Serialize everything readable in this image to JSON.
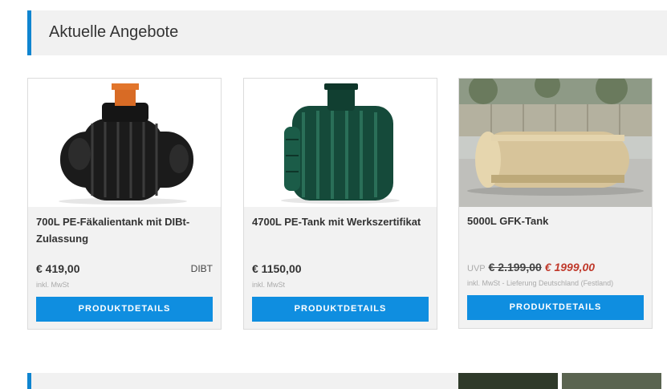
{
  "section": {
    "title": "Aktuelle Angebote"
  },
  "products": [
    {
      "title": "700L PE-Fäkalientank mit DIBt-Zulassung",
      "price": "€ 419,00",
      "badge": "DIBT",
      "tax": "inkl. MwSt",
      "button": "PRODUKTDETAILS"
    },
    {
      "title": "4700L PE-Tank mit Werkszertifikat",
      "price": "€ 1150,00",
      "tax": "inkl. MwSt",
      "button": "PRODUKTDETAILS"
    },
    {
      "title": "5000L GFK-Tank",
      "uvp_label": "UVP",
      "old_price": "€ 2.199,00",
      "price": "€ 1999,00",
      "tax": "inkl. MwSt - Lieferung Deutschland (Festland)",
      "button": "PRODUKTDETAILS"
    }
  ],
  "colors": {
    "accent": "#0f85d0",
    "button": "#0f8ee0",
    "sale_price": "#c0392b",
    "card_bg": "#f2f2f2"
  }
}
